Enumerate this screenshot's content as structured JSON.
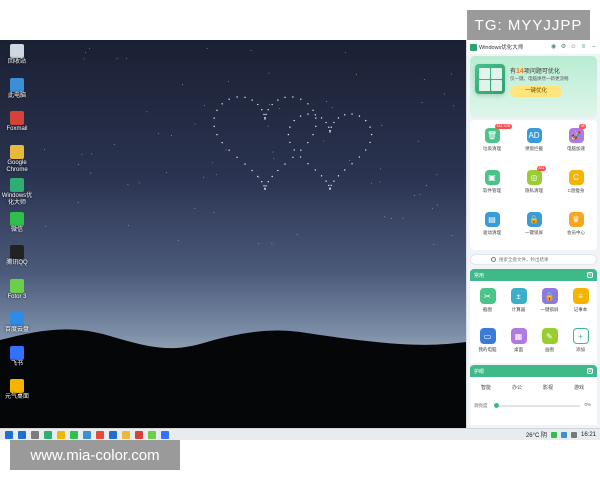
{
  "watermarks": {
    "top": "TG: MYYJJPP",
    "bottom": "www.mia-color.com"
  },
  "desktop_icons": [
    {
      "label": "回收站",
      "icon": "recycle-bin-icon",
      "color": "#cfd8e0"
    },
    {
      "label": "此电脑",
      "icon": "this-pc-icon",
      "color": "#3a8fd6"
    },
    {
      "label": "Foxmail",
      "icon": "foxmail-icon",
      "color": "#d6413a"
    },
    {
      "label": "Google\nChrome",
      "icon": "chrome-icon",
      "color": "#e8b93a"
    },
    {
      "label": "Windows优\n化大师",
      "icon": "optimizer-icon",
      "color": "#2fae74"
    },
    {
      "label": "微信",
      "icon": "wechat-icon",
      "color": "#2fbf4a"
    },
    {
      "label": "腾讯QQ",
      "icon": "qq-icon",
      "color": "#222222"
    },
    {
      "label": "Fotor 3",
      "icon": "fotor-icon",
      "color": "#6ccf4a"
    },
    {
      "label": "百度云盘",
      "icon": "baidu-cloud-icon",
      "color": "#2e8ce6"
    },
    {
      "label": "飞书",
      "icon": "feishu-icon",
      "color": "#3370ff"
    },
    {
      "label": "元气桌面",
      "icon": "desktop-app-icon",
      "color": "#f5b400"
    }
  ],
  "taskbar": {
    "apps": [
      "#1f6fd1",
      "#7b7b7b",
      "#2fae74",
      "#f2b705",
      "#2fbf4a",
      "#3a8fd6",
      "#e34b3a",
      "#1f6fd1",
      "#e8b93a",
      "#d6413a",
      "#6ccf4a",
      "#3370ff"
    ],
    "weather": "26°C 阴",
    "time": "16:21"
  },
  "app": {
    "title": "Windows优化大师",
    "hero": {
      "count": "14",
      "prefix": "有",
      "suffix": "项问题可优化",
      "subtitle": "仅一键，电脑焕然一新更流畅",
      "button": "一键优化"
    },
    "tools": [
      {
        "name": "垃圾清理",
        "color": "#4cc38a",
        "glyph": "🗑",
        "badge": "182.7GB"
      },
      {
        "name": "弹窗拦截",
        "color": "#3a9bd9",
        "glyph": "AD",
        "badge": ""
      },
      {
        "name": "电脑加速",
        "color": "#b07be0",
        "glyph": "🚀",
        "badge": "28"
      },
      {
        "name": "软件管理",
        "color": "#4cc38a",
        "glyph": "▣",
        "badge": ""
      },
      {
        "name": "隐私清理",
        "color": "#9acd32",
        "glyph": "◎",
        "badge": "831"
      },
      {
        "name": "C盘瘦身",
        "color": "#f5b400",
        "glyph": "C",
        "badge": ""
      },
      {
        "name": "驱动清理",
        "color": "#3a9bd9",
        "glyph": "▤",
        "badge": ""
      },
      {
        "name": "一键锁屏",
        "color": "#3a9bd9",
        "glyph": "🔒",
        "badge": ""
      },
      {
        "name": "会员中心",
        "color": "#f5a623",
        "glyph": "♛",
        "badge": ""
      }
    ],
    "search_placeholder": "搜索全盘文件，秒出结果",
    "section_common": "常用",
    "common": [
      {
        "name": "截图",
        "color": "#4cc38a",
        "glyph": "✂"
      },
      {
        "name": "计算器",
        "color": "#3ab0c8",
        "glyph": "±"
      },
      {
        "name": "一键锁屏",
        "color": "#8a7be0",
        "glyph": "🔒"
      },
      {
        "name": "记事本",
        "color": "#f5b400",
        "glyph": "≡"
      },
      {
        "name": "我的电脑",
        "color": "#3a7bd9",
        "glyph": "▭"
      },
      {
        "name": "桌面",
        "color": "#b07be0",
        "glyph": "▦"
      },
      {
        "name": "画图",
        "color": "#9acd32",
        "glyph": "✎"
      },
      {
        "name": "添加",
        "color": "#ffffff",
        "glyph": "+"
      }
    ],
    "section_eye": "护眼",
    "modes": [
      "智能",
      "办公",
      "影视",
      "游戏"
    ],
    "brightness_label": "调亮度",
    "brightness_value": "0%",
    "brightness_level": 0
  }
}
